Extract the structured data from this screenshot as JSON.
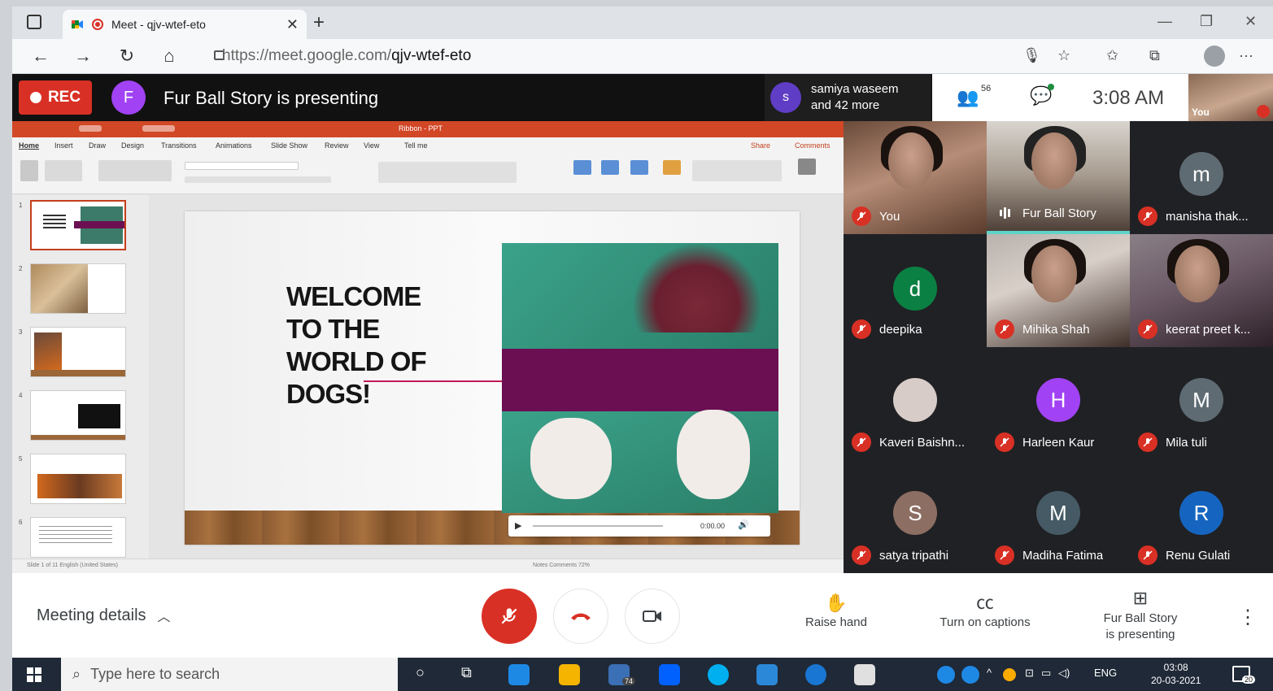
{
  "browser": {
    "tab_title": "Meet - qjv-wtef-eto",
    "url_host": "https://meet.google.com/",
    "url_path": "qjv-wtef-eto"
  },
  "meet_top": {
    "rec_label": "REC",
    "presenter_initial": "F",
    "presenting_text": "Fur Ball Story is presenting",
    "join_notice_initial": "s",
    "join_notice_line1": "samiya waseem",
    "join_notice_line2": "and 42 more",
    "participant_count": "56",
    "time": "3:08 AM",
    "self_label": "You"
  },
  "ppt": {
    "file_name": "Ribbon - PPT",
    "tabs": [
      "Home",
      "Insert",
      "Draw",
      "Design",
      "Transitions",
      "Animations",
      "Slide Show",
      "Review",
      "View",
      "Tell me"
    ],
    "share_label": "Share",
    "comments_label": "Comments",
    "status_left": "Slide 1 of 11   English (United States)",
    "status_right": "Notes   Comments   72%",
    "video_time": "0:00.00"
  },
  "slide": {
    "heading_line1": "WELCOME",
    "heading_line2": "TO THE",
    "heading_line3": "WORLD OF",
    "heading_line4": "DOGS!"
  },
  "thumbnails": [
    "1",
    "2",
    "3",
    "4",
    "5",
    "6"
  ],
  "participants": [
    {
      "name": "You",
      "initial": "",
      "color": "",
      "video": true,
      "muted": true
    },
    {
      "name": "Fur Ball Story",
      "initial": "",
      "color": "",
      "video": true,
      "muted": false
    },
    {
      "name": "manisha thak...",
      "initial": "m",
      "color": "#5f6b73",
      "video": false,
      "muted": true
    },
    {
      "name": "deepika",
      "initial": "d",
      "color": "#0b8043",
      "video": false,
      "muted": true
    },
    {
      "name": "Mihika Shah",
      "initial": "",
      "color": "",
      "video": true,
      "muted": true
    },
    {
      "name": "keerat preet k...",
      "initial": "",
      "color": "",
      "video": true,
      "muted": true
    },
    {
      "name": "Kaveri Baishn...",
      "initial": "",
      "color": "#d7ccc8",
      "video": false,
      "muted": true
    },
    {
      "name": "Harleen Kaur",
      "initial": "H",
      "color": "#a142f4",
      "video": false,
      "muted": true
    },
    {
      "name": "Mila tuli",
      "initial": "M",
      "color": "#5f6b73",
      "video": false,
      "muted": true
    },
    {
      "name": "satya tripathi",
      "initial": "S",
      "color": "#8d6e63",
      "video": false,
      "muted": true
    },
    {
      "name": "Madiha Fatima",
      "initial": "M",
      "color": "#455a64",
      "video": false,
      "muted": true
    },
    {
      "name": "Renu Gulati",
      "initial": "R",
      "color": "#1565c0",
      "video": false,
      "muted": true
    }
  ],
  "controls": {
    "meeting_details": "Meeting details",
    "raise_hand": "Raise hand",
    "captions": "Turn on captions",
    "presenting_line1": "Fur Ball Story",
    "presenting_line2": "is presenting"
  },
  "taskbar": {
    "search_placeholder": "Type here to search",
    "mail_badge": "74",
    "lang": "ENG",
    "time": "03:08",
    "date": "20-03-2021",
    "notif_count": "20"
  },
  "colors": {
    "rec": "#d93025",
    "meet_dark": "#202124",
    "ppt_orange": "#d24726",
    "slide_band": "#6b0f52"
  }
}
